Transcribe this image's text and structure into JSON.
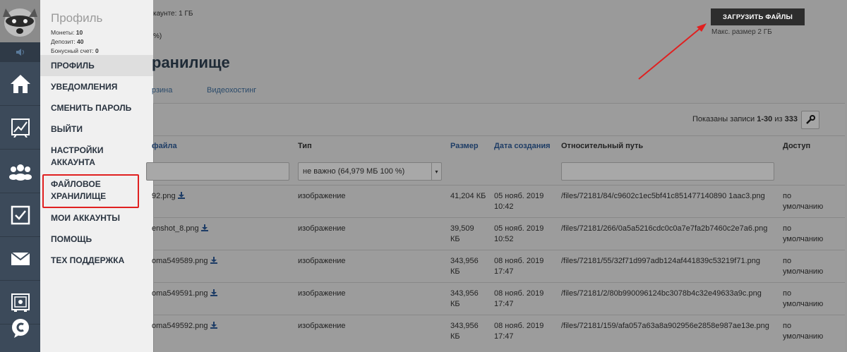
{
  "menu": {
    "title": "Профиль",
    "coins_label": "Монеты:",
    "coins": "10",
    "deposit_label": "Депозит:",
    "deposit": "40",
    "bonus_label": "Бонусный счет:",
    "bonus": "0",
    "items": [
      "ПРОФИЛЬ",
      "УВЕДОМЛЕНИЯ",
      "СМЕНИТЬ ПАРОЛЬ",
      "ВЫЙТИ",
      "НАСТРОЙКИ АККАУНТА",
      "ФАЙЛОВОЕ ХРАНИЛИЩЕ",
      "МОИ АККАУНТЫ",
      "ПОМОЩЬ",
      "ТЕХ ПОДДЕРЖКА"
    ]
  },
  "rail_icons": [
    "home-icon",
    "chart-icon",
    "users-icon",
    "checkbox-icon",
    "mail-icon",
    "safe-icon",
    "chat-icon"
  ],
  "main": {
    "account_text": "каунте: 1 ГБ",
    "percent_text": "%)",
    "upload_label": "ЗАГРУЗИТЬ ФАЙЛЫ",
    "max_size": "Макс. размер 2 ГБ",
    "page_title": "ранилище",
    "tabs": [
      "рзина",
      "Видеохостинг"
    ],
    "records_prefix": "Показаны записи ",
    "records_range": "1-30",
    "records_mid": " из ",
    "records_total": "333",
    "headers": [
      "файла",
      "Тип",
      "Размер",
      "Дата создания",
      "Относительный путь",
      "Доступ"
    ],
    "type_filter": "не важно (64,979 МБ 100 %)",
    "rows": [
      {
        "name": "92.png",
        "type": "изображение",
        "size1": "41,204 КБ",
        "size2": "",
        "date1": "05 нояб. 2019",
        "date2": "10:42",
        "path": "/files/72181/84/c9602c1ec5bf41c851477140890 1aac3.png",
        "access1": "по",
        "access2": "умолчанию"
      },
      {
        "name": "enshot_8.png",
        "type": "изображение",
        "size1": "39,509",
        "size2": "КБ",
        "date1": "05 нояб. 2019",
        "date2": "10:52",
        "path": "/files/72181/266/0a5a5216cdc0c0a7e7fa2b7460c2e7a6.png",
        "access1": "по",
        "access2": "умолчанию"
      },
      {
        "name": "oma549589.png",
        "type": "изображение",
        "size1": "343,956",
        "size2": "КБ",
        "date1": "08 нояб. 2019",
        "date2": "17:47",
        "path": "/files/72181/55/32f71d997adb124af441839c53219f71.png",
        "access1": "по",
        "access2": "умолчанию"
      },
      {
        "name": "oma549591.png",
        "type": "изображение",
        "size1": "343,956",
        "size2": "КБ",
        "date1": "08 нояб. 2019",
        "date2": "17:47",
        "path": "/files/72181/2/80b990096124bc3078b4c32e49633a9c.png",
        "access1": "по",
        "access2": "умолчанию"
      },
      {
        "name": "oma549592.png",
        "type": "изображение",
        "size1": "343,956",
        "size2": "КБ",
        "date1": "08 нояб. 2019",
        "date2": "17:47",
        "path": "/files/72181/159/afa057a63a8a902956e2858e987ae13e.png",
        "access1": "по",
        "access2": "умолчанию"
      }
    ]
  }
}
